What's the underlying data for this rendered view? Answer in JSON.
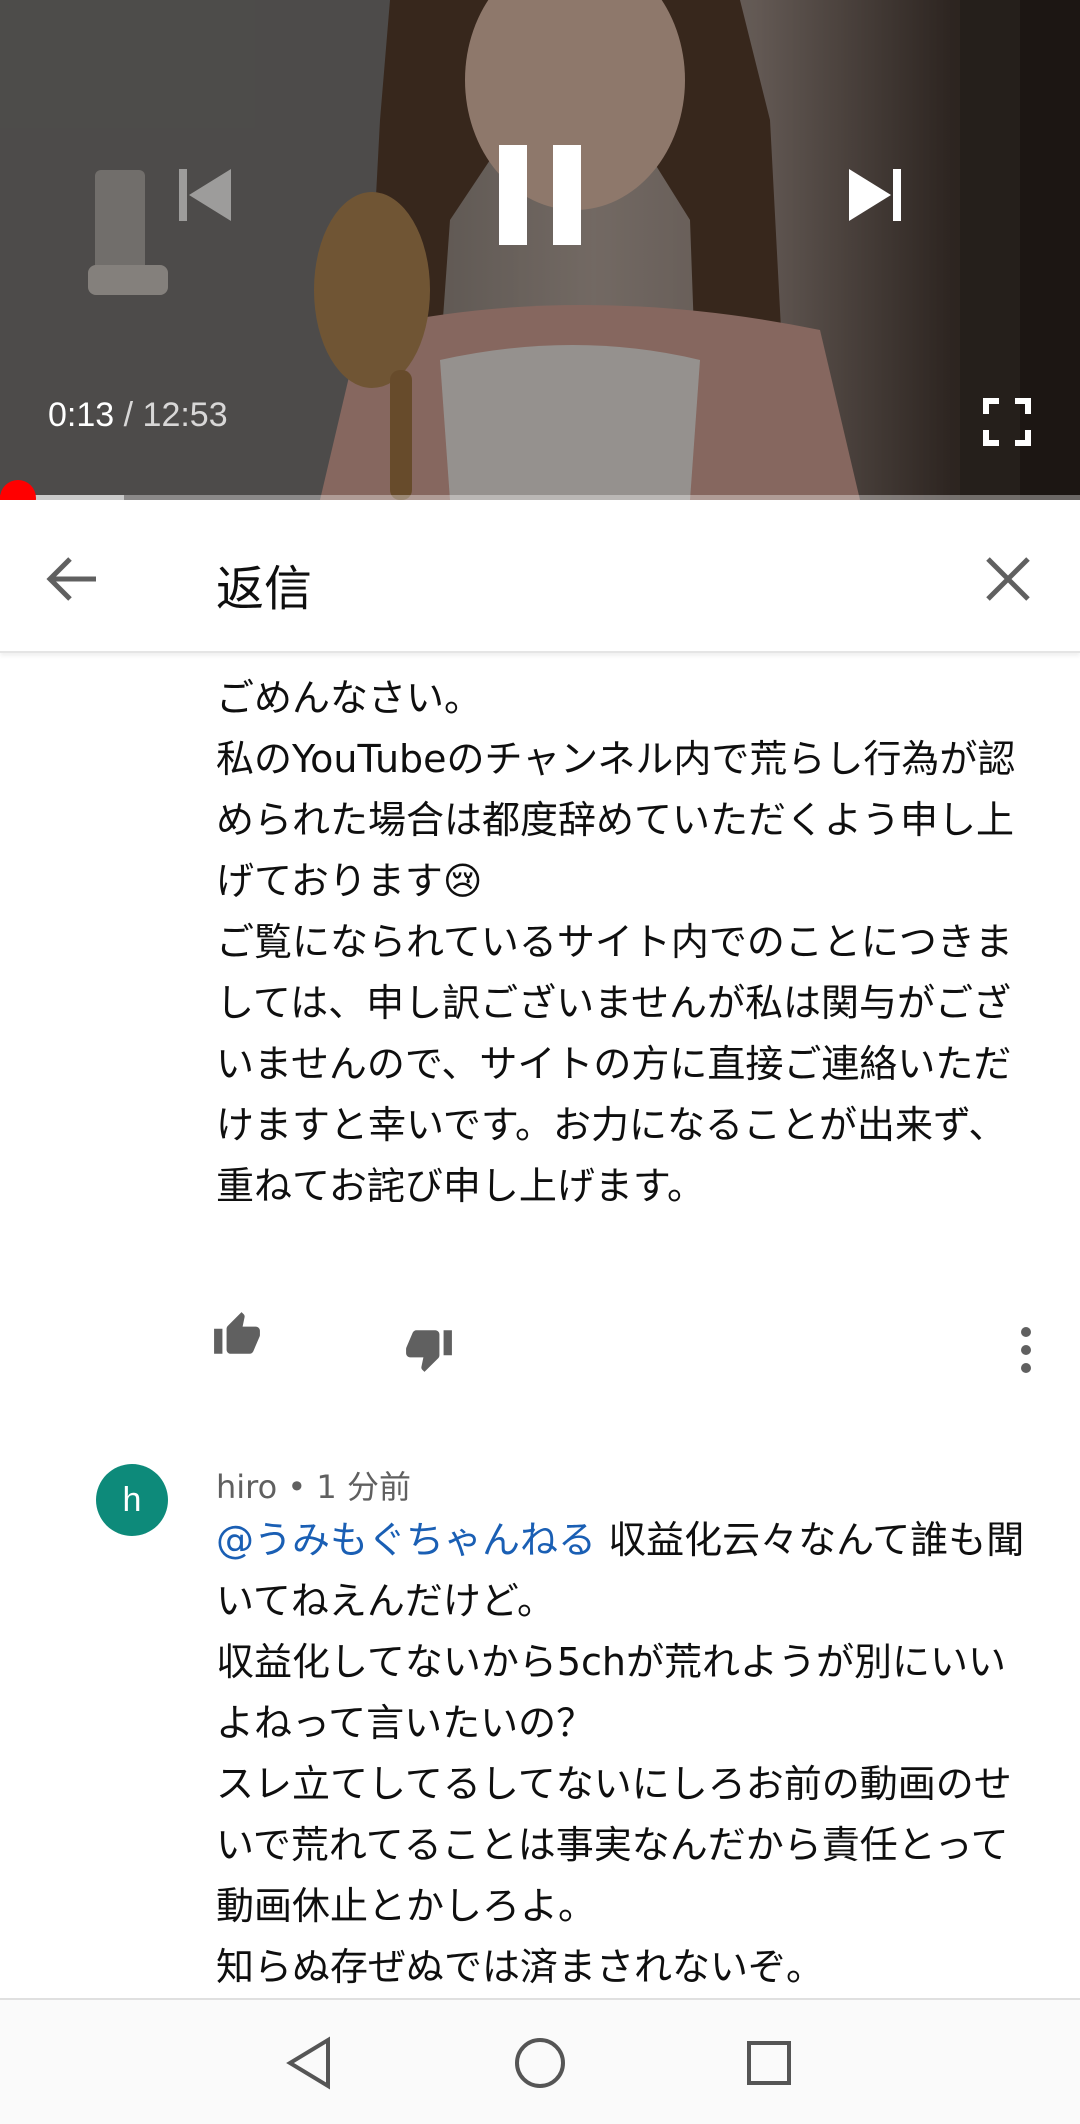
{
  "player": {
    "current_time": "0:13",
    "separator": " / ",
    "duration": "12:53",
    "progress_fraction": 0.017,
    "buffered_fraction": 0.115,
    "accent_color": "#ff0000",
    "icons": [
      "previous-icon",
      "pause-icon",
      "next-icon",
      "fullscreen-icon"
    ]
  },
  "header": {
    "title": "返信",
    "icons": [
      "back-arrow-icon",
      "close-icon"
    ]
  },
  "reply_1": {
    "text": "ごめんなさい。\n私のYouTubeのチャンネル内で荒らし行為が認められた場合は都度辞めていただくよう申し上げております😢\nご覧になられているサイト内でのことにつきましては、申し訳ございませんが私は関与がございませんので、サイトの方に直接ご連絡いただけますと幸いです。お力になることが出来ず、重ねてお詫び申し上げます。",
    "icons": [
      "thumbs-up-icon",
      "thumbs-down-icon",
      "more-vert-icon"
    ]
  },
  "reply_2": {
    "avatar_letter": "h",
    "avatar_color": "#0d8a7a",
    "author": "hiro",
    "bullet": " • ",
    "time": "1 分前",
    "mention": "@うみもぐちゃんねる",
    "text": " 収益化云々なんて誰も聞いてねえんだけど。\n収益化してないから5chが荒れようが別にいいよねって言いたいの？\nスレ立てしてるしてないにしろお前の動画のせいで荒れてることは事実なんだから責任とって動画休止とかしろよ。\n知らぬ存ぜぬでは済まされないぞ。",
    "mention_color": "#1a5fb4"
  },
  "navbar": {
    "icons": [
      "nav-back-icon",
      "nav-home-icon",
      "nav-recents-icon"
    ]
  }
}
